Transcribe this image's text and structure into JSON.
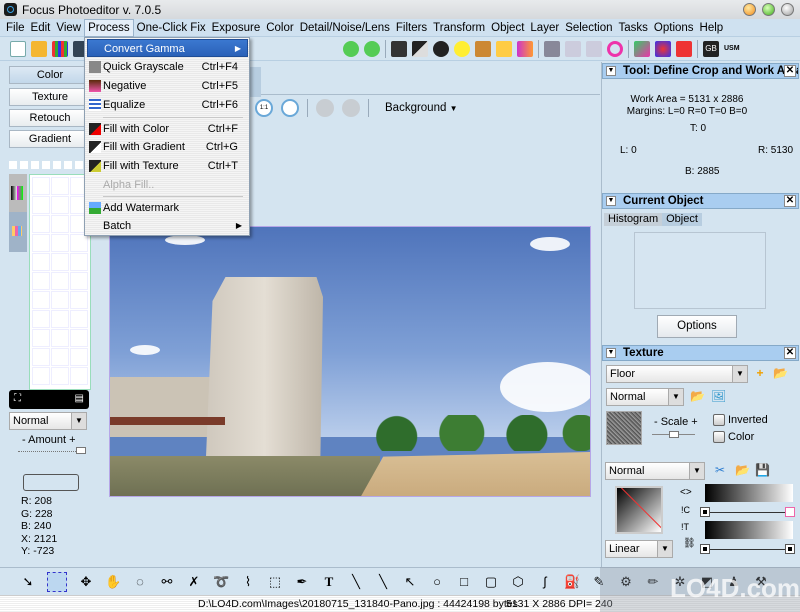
{
  "window": {
    "title": "Focus Photoeditor v. 7.0.5"
  },
  "menubar": [
    "File",
    "Edit",
    "View",
    "Process",
    "One-Click Fix",
    "Exposure",
    "Color",
    "Detail/Noise/Lens",
    "Filters",
    "Transform",
    "Object",
    "Layer",
    "Selection",
    "Tasks",
    "Options",
    "Help"
  ],
  "process_menu": {
    "items": [
      {
        "label": "Convert Gamma",
        "shortcut": "",
        "submenu": true,
        "highlighted": true
      },
      {
        "label": "Quick Grayscale",
        "shortcut": "Ctrl+F4"
      },
      {
        "label": "Negative",
        "shortcut": "Ctrl+F5"
      },
      {
        "label": "Equalize",
        "shortcut": "Ctrl+F6"
      },
      {
        "label": "Fill with Color",
        "shortcut": "Ctrl+F"
      },
      {
        "label": "Fill with Gradient",
        "shortcut": "Ctrl+G"
      },
      {
        "label": "Fill with Texture",
        "shortcut": "Ctrl+T"
      },
      {
        "label": "Alpha Fill..",
        "shortcut": "",
        "disabled": true
      },
      {
        "label": "Add Watermark",
        "shortcut": ""
      },
      {
        "label": "Batch",
        "shortcut": "",
        "submenu": true
      }
    ]
  },
  "left_panel": {
    "tabs": [
      "Color",
      "Texture",
      "Retouch",
      "Gradient"
    ],
    "blend_mode": "Normal",
    "amount_label": "- Amount +",
    "amount_value": 1.0,
    "readout": {
      "r": "R: 208",
      "g": "G: 228",
      "b": "B: 240",
      "x": "X: 2121",
      "y": "Y: -723"
    }
  },
  "canvas": {
    "layer_select": "Background",
    "zoom_1to1_label": "1:1"
  },
  "tool_panel": {
    "title": "Tool: Define Crop and Work Area",
    "work_area": "Work Area = 5131 x 2886",
    "margins": "Margins: L=0 R=0 T=0 B=0",
    "t": "T: 0",
    "l": "L: 0",
    "r": "R: 5130",
    "b": "B: 2885"
  },
  "current_object": {
    "title": "Current Object",
    "tabs": [
      "Histogram",
      "Object"
    ],
    "options_label": "Options"
  },
  "texture_panel": {
    "title": "Texture",
    "texture": "Floor",
    "blend_mode": "Normal",
    "scale_label": "- Scale +",
    "scale_value": 0.5,
    "inverted_label": "Inverted",
    "color_label": "Color",
    "gradient_mode": "Normal",
    "gradient_type": "Linear",
    "grad_tools": [
      "<>",
      "!C",
      "!T"
    ]
  },
  "status": {
    "path": "D:\\LO4D.com\\Images\\20180715_131840-Pano.jpg : 44424198 bytes",
    "dims": "5131 X 2886 DPI= 240"
  },
  "watermark": "LO4D.com"
}
